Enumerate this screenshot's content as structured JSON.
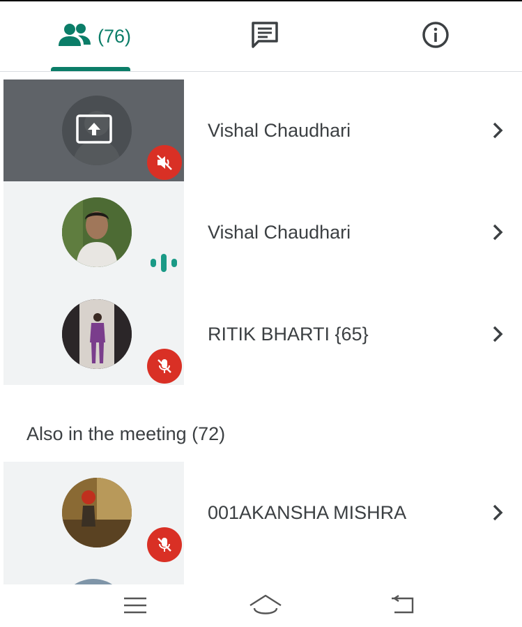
{
  "tabs": {
    "people_count": "(76)",
    "active": "people",
    "accent": "#0b7d68"
  },
  "participants": [
    {
      "name": "Vishal Chaudhari",
      "avatar": "presenting-screen-icon",
      "status": "muted",
      "presenting": true
    },
    {
      "name": "Vishal Chaudhari",
      "avatar": "photo",
      "status": "speaking",
      "presenting": false
    },
    {
      "name": "RITIK BHARTI {65}",
      "avatar": "photo",
      "status": "muted",
      "presenting": false
    }
  ],
  "section": {
    "label": "Also in the meeting (72)"
  },
  "others": [
    {
      "name": "001AKANSHA MISHRA",
      "avatar": "photo",
      "status": "muted"
    }
  ],
  "colors": {
    "muted_badge": "#d93025",
    "speaking": "#1a9a86",
    "tile_bg": "#f1f3f4",
    "presenting_bg": "#5f6368"
  },
  "navigation": {
    "icons": [
      "menu-icon",
      "home-icon",
      "back-icon"
    ]
  }
}
